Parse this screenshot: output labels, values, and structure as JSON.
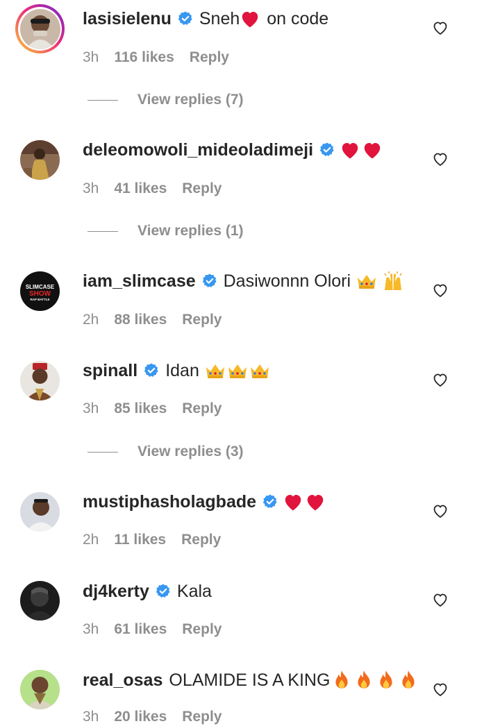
{
  "comments": [
    {
      "username": "lasisielenu",
      "verified": true,
      "text_before": "Sneh",
      "emojis_mid": [
        "heart"
      ],
      "text_after": " on code",
      "time": "3h",
      "likes": "116 likes",
      "reply": "Reply",
      "view_replies": "View replies (7)",
      "avatar": "avatar-photo-lasisielenu",
      "story_ring": true
    },
    {
      "username": "deleomowoli_mideoladimeji",
      "verified": true,
      "text_before": "",
      "emojis_mid": [
        "heart",
        "heart"
      ],
      "text_after": "",
      "time": "3h",
      "likes": "41 likes",
      "reply": "Reply",
      "view_replies": "View replies (1)",
      "avatar": "avatar-photo-deleomowoli"
    },
    {
      "username": "iam_slimcase",
      "verified": true,
      "text_before": "Dasiwonnn Olori ",
      "emojis_mid": [
        "crown",
        "raised-hands"
      ],
      "text_after": "",
      "time": "2h",
      "likes": "88 likes",
      "reply": "Reply",
      "view_replies": "",
      "avatar": "avatar-logo-slimcase",
      "avatar_text": [
        "SLIMCASE",
        "SHOW",
        "RAP BATTLE"
      ]
    },
    {
      "username": "spinall",
      "verified": true,
      "text_before": "Idan ",
      "emojis_mid": [
        "crown",
        "crown",
        "crown"
      ],
      "text_after": "",
      "time": "3h",
      "likes": "85 likes",
      "reply": "Reply",
      "view_replies": "View replies (3)",
      "avatar": "avatar-photo-spinall"
    },
    {
      "username": "mustiphasholagbade",
      "verified": true,
      "text_before": "",
      "emojis_mid": [
        "heart",
        "heart"
      ],
      "text_after": "",
      "time": "2h",
      "likes": "11 likes",
      "reply": "Reply",
      "view_replies": "",
      "avatar": "avatar-photo-mustiphasholagbade"
    },
    {
      "username": "dj4kerty",
      "verified": true,
      "text_before": "Kala",
      "emojis_mid": [],
      "text_after": "",
      "time": "3h",
      "likes": "61 likes",
      "reply": "Reply",
      "view_replies": "",
      "avatar": "avatar-photo-dj4kerty"
    },
    {
      "username": "real_osas",
      "verified": false,
      "text_before": "OLAMIDE IS A KING",
      "emojis_mid": [
        "fire",
        "fire",
        "fire",
        "fire"
      ],
      "text_after": "",
      "time": "3h",
      "likes": "20 likes",
      "reply": "Reply",
      "view_replies": "",
      "avatar": "avatar-photo-real_osas"
    }
  ],
  "colors": {
    "text": "#262626",
    "secondary": "#8e8e8e",
    "verified_blue": "#3897f0",
    "heart_red": "#e0143c"
  }
}
